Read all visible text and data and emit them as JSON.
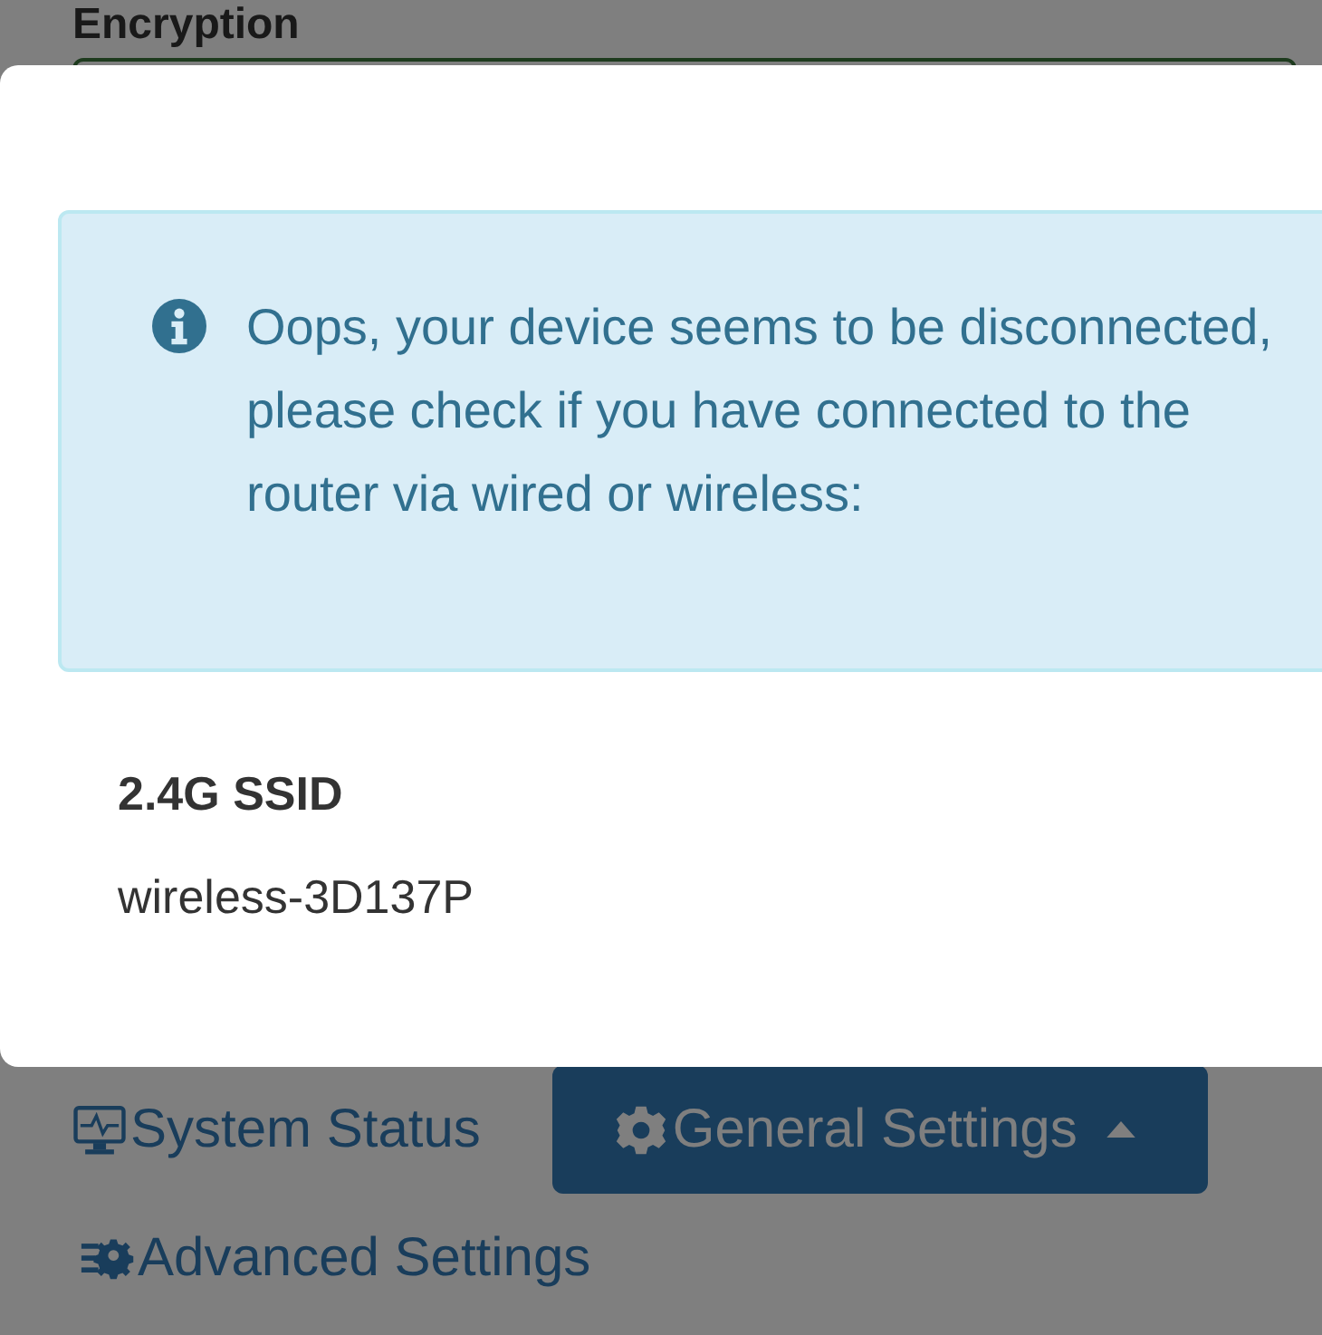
{
  "page": {
    "field_label": "Encryption"
  },
  "nav": [
    {
      "label": "System Status",
      "selected": false
    },
    {
      "label": "General Settings",
      "selected": true,
      "expanded": true
    },
    {
      "label": "Advanced Settings",
      "selected": false
    }
  ],
  "dialog": {
    "alert": "Oops, your device seems to be disconnected, please check if you have connected to the router via wired or wireless:",
    "ssid_label": "2.4G SSID",
    "ssid_value": "wireless-3D137P"
  }
}
